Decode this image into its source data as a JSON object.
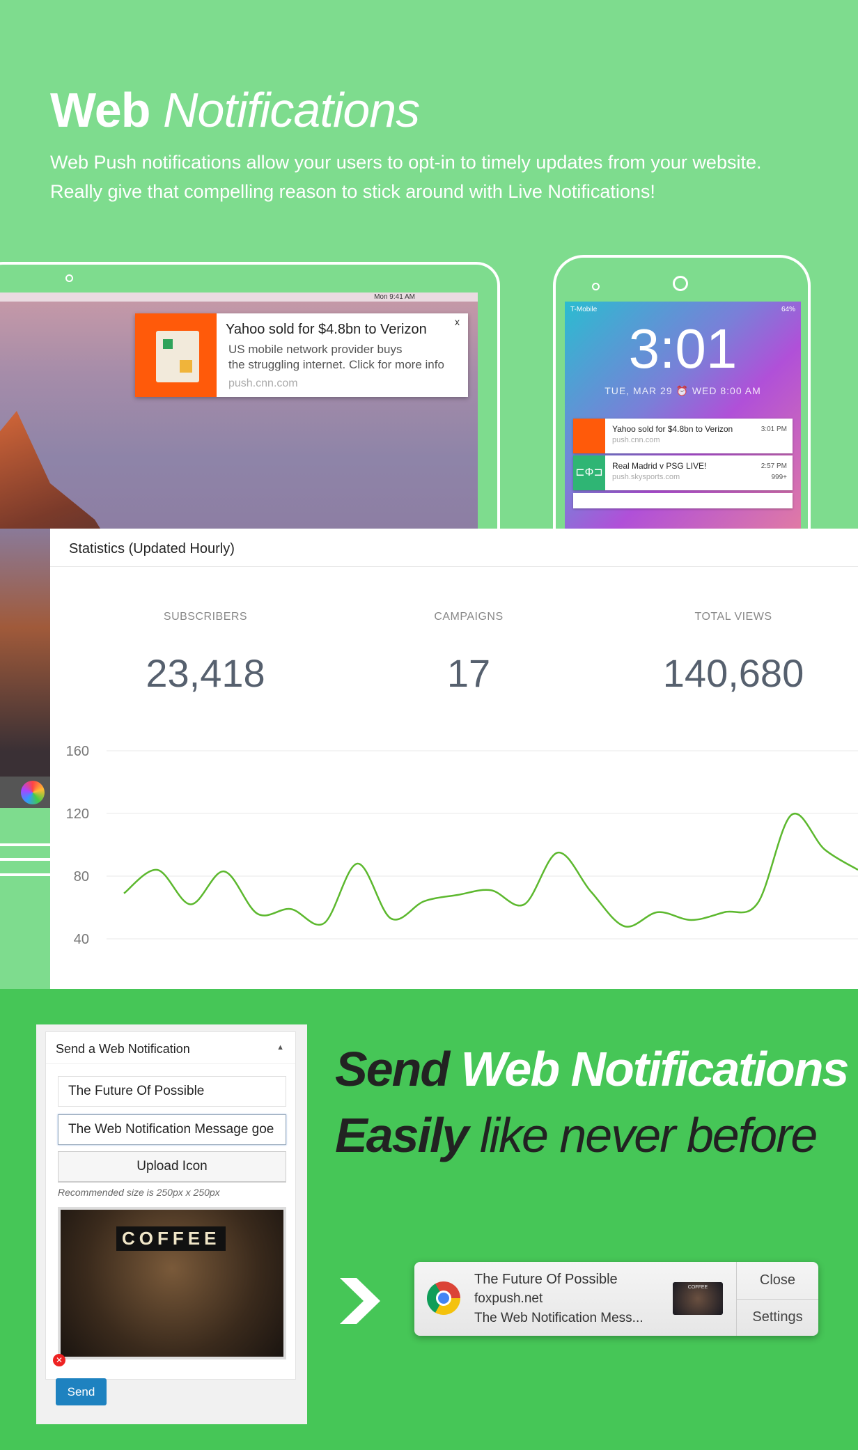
{
  "hero": {
    "title_bold": "Web",
    "title_light": "Notifications",
    "subtitle_1": "Web Push notifications allow your users to opt-in to timely updates from your website.",
    "subtitle_2": "Really give that compelling reason to stick around with Live Notifications!"
  },
  "desktop": {
    "menubar_time": "Mon 9:41 AM",
    "notification": {
      "title": "Yahoo sold for $4.8bn to Verizon",
      "body_1": "US mobile network provider buys",
      "body_2": "the struggling internet. Click for more info",
      "source": "push.cnn.com",
      "close": "x"
    }
  },
  "phone": {
    "carrier": "T-Mobile",
    "battery": "64%",
    "time": "3:01",
    "date": "TUE, MAR 29",
    "alarm": "WED 8:00 AM",
    "notifications": [
      {
        "title": "Yahoo sold for $4.8bn to Verizon",
        "source": "push.cnn.com",
        "time": "3:01 PM"
      },
      {
        "title": "Real Madrid v PSG LIVE!",
        "source": "push.skysports.com",
        "time": "2:57 PM",
        "count": "999+"
      }
    ]
  },
  "stats": {
    "header": "Statistics (Updated Hourly)",
    "metrics": [
      {
        "label": "SUBSCRIBERS",
        "value": "23,418"
      },
      {
        "label": "CAMPAIGNS",
        "value": "17"
      },
      {
        "label": "TOTAL VIEWS",
        "value": "140,680"
      }
    ]
  },
  "chart_data": {
    "type": "line",
    "values": [
      69,
      84,
      62,
      83,
      56,
      59,
      50,
      88,
      53,
      64,
      68,
      71,
      62,
      95,
      70,
      48,
      57,
      52,
      57,
      63,
      119,
      97,
      84
    ],
    "yticks": [
      "160",
      "120",
      "80",
      "40"
    ],
    "ylim": [
      40,
      160
    ],
    "grid": true,
    "color": "#5cb82e"
  },
  "form": {
    "header": "Send a Web Notification",
    "title_value": "The Future Of Possible",
    "message_value": "The Web Notification Message goe",
    "upload_label": "Upload Icon",
    "hint": "Recommended size is 250px x 250px",
    "image_text": "COFFEE",
    "send_label": "Send"
  },
  "headline": {
    "line1_dark": "Send",
    "line1_light": "Web Notifications",
    "line2_dark": "Easily",
    "line2_light": "like never before"
  },
  "chrome_notification": {
    "title": "The Future Of Possible",
    "site": "foxpush.net",
    "message": "The Web Notification Mess...",
    "thumb_text": "COFFEE",
    "close": "Close",
    "settings": "Settings"
  },
  "colors": {
    "top_bg": "#7edc8e",
    "bottom_bg": "#46c657",
    "accent_orange": "#ff5a0a",
    "send_blue": "#1e82c0"
  }
}
